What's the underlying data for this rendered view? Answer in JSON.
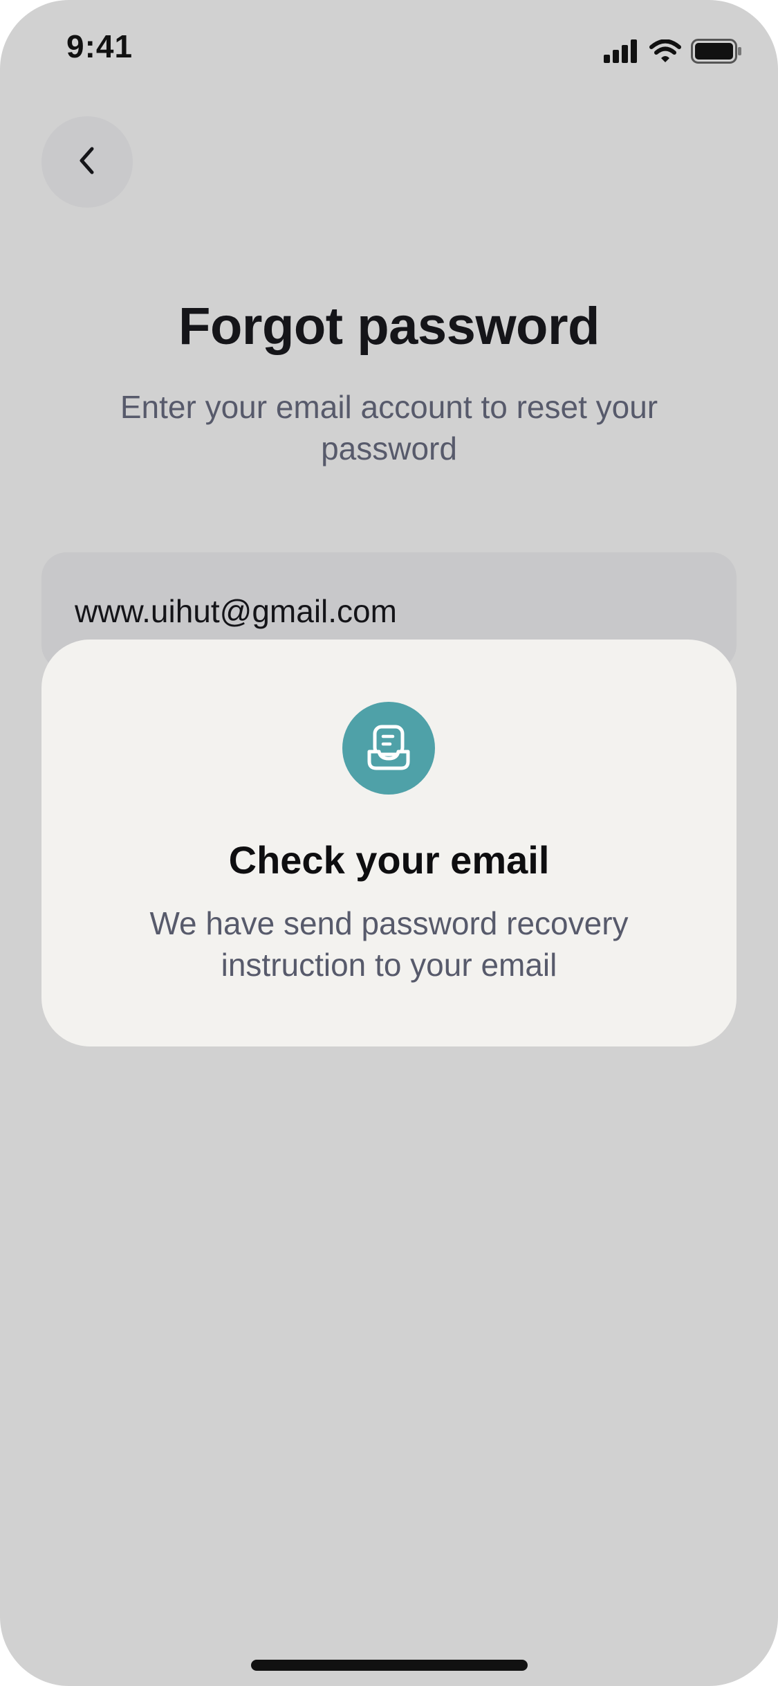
{
  "status_bar": {
    "time": "9:41",
    "icons": [
      "signal-icon",
      "wifi-icon",
      "battery-icon"
    ]
  },
  "header": {
    "back_icon": "chevron-left-icon"
  },
  "main": {
    "title": "Forgot password",
    "subtitle": "Enter your email account to reset your password",
    "email_value": "www.uihut@gmail.com"
  },
  "modal": {
    "icon": "inbox-icon",
    "title": "Check your email",
    "body": "We have send password recovery instruction to your email"
  },
  "colors": {
    "background": "#d1d1d1",
    "card": "#f3f2ef",
    "accent": "#4fa1a8",
    "title_text": "#151519",
    "muted_text": "#575a6b"
  }
}
